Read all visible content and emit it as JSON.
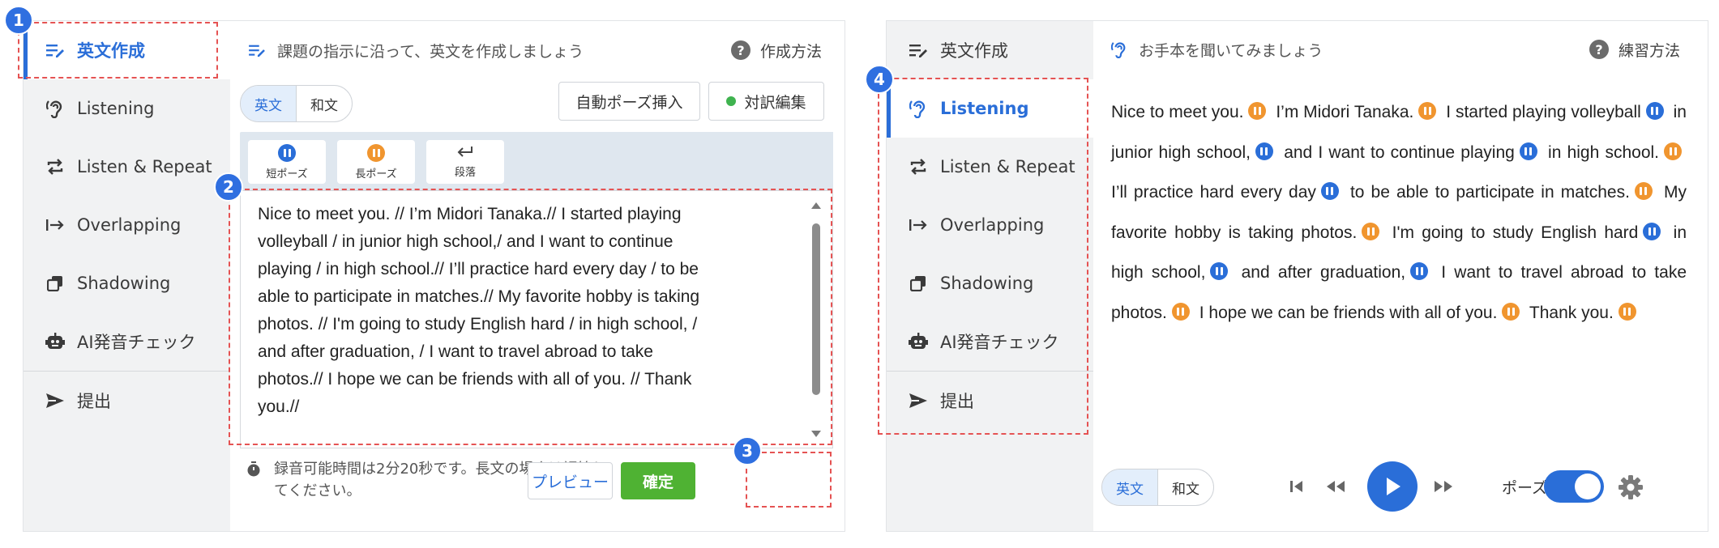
{
  "left_panel": {
    "sidebar": [
      {
        "label": "英文作成",
        "icon": "edit-lines-icon",
        "active": true
      },
      {
        "label": "Listening",
        "icon": "ear-icon"
      },
      {
        "label": "Listen & Repeat",
        "icon": "repeat-icon"
      },
      {
        "label": "Overlapping",
        "icon": "arrow-to-line-icon"
      },
      {
        "label": "Shadowing",
        "icon": "copy-icon"
      },
      {
        "label": "AI発音チェック",
        "icon": "robot-icon"
      },
      {
        "label": "提出",
        "icon": "send-icon"
      }
    ],
    "header": {
      "instruction": "課題の指示に沿って、英文を作成しましょう",
      "help": "作成方法"
    },
    "lang_toggle": {
      "en": "英文",
      "ja": "和文",
      "selected": "英文"
    },
    "buttons": {
      "auto_pause": "自動ポーズ挿入",
      "translation_edit": "対訳編集"
    },
    "toolbar": {
      "short_pause": "短ポーズ",
      "long_pause": "長ポーズ",
      "paragraph": "段落"
    },
    "editor_lines": [
      "Nice to meet you. // I’m Midori Tanaka.// I started playing",
      "volleyball / in junior high school,/ and I want to continue",
      "playing / in high school.// I’ll practice hard every day / to be",
      "able to participate in matches.// My favorite hobby is taking",
      "photos. // I'm going to study English hard / in high school, /",
      "and after graduation, / I want to travel abroad to take",
      "photos.// I hope we can be friends with all of you. // Thank",
      "you.//"
    ],
    "footer": {
      "note": "録音可能時間は2分20秒です。長文の場合は調節してください。",
      "preview": "プレビュー",
      "confirm": "確定"
    }
  },
  "right_panel": {
    "sidebar": [
      {
        "label": "英文作成",
        "icon": "edit-lines-icon"
      },
      {
        "label": "Listening",
        "icon": "ear-icon",
        "active": true
      },
      {
        "label": "Listen & Repeat",
        "icon": "repeat-icon"
      },
      {
        "label": "Overlapping",
        "icon": "arrow-to-line-icon"
      },
      {
        "label": "Shadowing",
        "icon": "copy-icon"
      },
      {
        "label": "AI発音チェック",
        "icon": "robot-icon"
      },
      {
        "label": "提出",
        "icon": "send-icon"
      }
    ],
    "header": {
      "instruction": "お手本を聞いてみましょう",
      "help": "練習方法"
    },
    "segments": [
      {
        "t": "Nice to meet you.",
        "p": "long"
      },
      {
        "t": "I’m Midori Tanaka.",
        "p": "long"
      },
      {
        "t": "I started playing volleyball",
        "p": "short"
      },
      {
        "t": "in junior high school,",
        "p": "short"
      },
      {
        "t": "and I want to continue playing",
        "p": "short"
      },
      {
        "t": "in high school.",
        "p": "long"
      },
      {
        "t": "I’ll practice hard every day",
        "p": "short"
      },
      {
        "t": "to be able to participate in matches.",
        "p": "long"
      },
      {
        "t": "My favorite hobby is taking photos.",
        "p": "long"
      },
      {
        "t": "I'm going to study English hard",
        "p": "short"
      },
      {
        "t": "in high school,",
        "p": "short"
      },
      {
        "t": "and after graduation,",
        "p": "short"
      },
      {
        "t": "I want to travel abroad to take photos.",
        "p": "long"
      },
      {
        "t": "I hope we can be friends with all of you.",
        "p": "long"
      },
      {
        "t": "Thank you.",
        "p": "long"
      }
    ],
    "player": {
      "en": "英文",
      "ja": "和文",
      "pause_label": "ポーズ",
      "pause_on": true
    }
  },
  "callouts": [
    "1",
    "2",
    "3",
    "4"
  ],
  "colors": {
    "accent": "#2a6ed8",
    "short_pause": "#2a6ed8",
    "long_pause": "#f0952f",
    "confirm": "#4fb233",
    "highlight": "#e55353",
    "badge": "#2f6fe0"
  }
}
